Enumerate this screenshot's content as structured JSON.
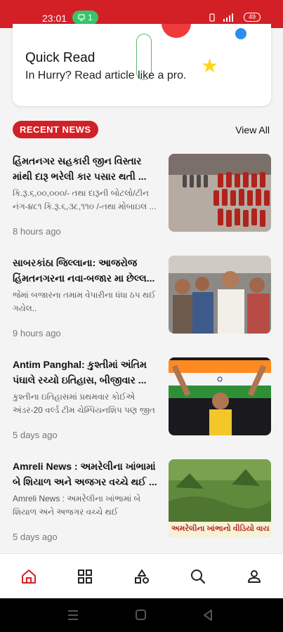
{
  "status": {
    "time": "23:01",
    "pill_count": "1",
    "battery": "49",
    "colors": {
      "bar": "#d32027",
      "pill": "#36c56a"
    }
  },
  "quick_read": {
    "title": "Quick Read",
    "subtitle": "In Hurry? Read article like a pro."
  },
  "section": {
    "badge": "RECENT NEWS",
    "view_all": "View All"
  },
  "news": [
    {
      "title": "હિંમતનગર સહકારી જીન વિસ્તાર\nમાંથી દારૂ ભરેલી કાર પસાર થતી ...",
      "desc": "કિ.રૂ.૬,૦૦,૦૦૦/- તથા દારૂની બોટલો/ટીન\nનંગ-૪૮૧ કિ.રૂ.૬,૩૮,૧૧૦ /-તથા મોબાઇલ ...",
      "time": "8 hours ago"
    },
    {
      "title": "સાબરકાંઠા જિલ્લાના: આજરોજ\nહિંમતનગરના નવા-બજાર મા છેલ્લ...",
      "desc": "જેમાં બજારના તમામ વેપારીના ધંધા ઠપ થઈ\nગયેલ..",
      "time": "9 hours ago"
    },
    {
      "title": "Antim Panghal: કુશ્તીમાં અંતિમ\nપંઘાલે રચ્યો ઇતિહાસ, બીજીવાર ...",
      "desc": "કુશ્તીના ઇતિહાસમાં પ્રથમવાર કોઈએ\nઅંડર-20 વર્લ્ડ ટીમ ચેમ્પિયનશિપ પણ જીત ...",
      "time": "5 days ago"
    },
    {
      "title": "Amreli News : અમરેલીના ખાંભામાં\nબે શિયાળ અને અજગર વચ્ચે થઈ ...",
      "desc": "Amreli News : અમરેલીના ખાંભામાં બે\nશિયાળ અને અજગર વચ્ચે થઈ જબરજસ્ત...",
      "time": "5 days ago",
      "thumb_caption": "અમરેલીના ખાંભાનો વીડિયો વાય"
    }
  ],
  "nav": {
    "items": [
      "home-icon",
      "grid-icon",
      "categories-icon",
      "search-icon",
      "profile-icon"
    ],
    "active_color": "#d32027"
  }
}
